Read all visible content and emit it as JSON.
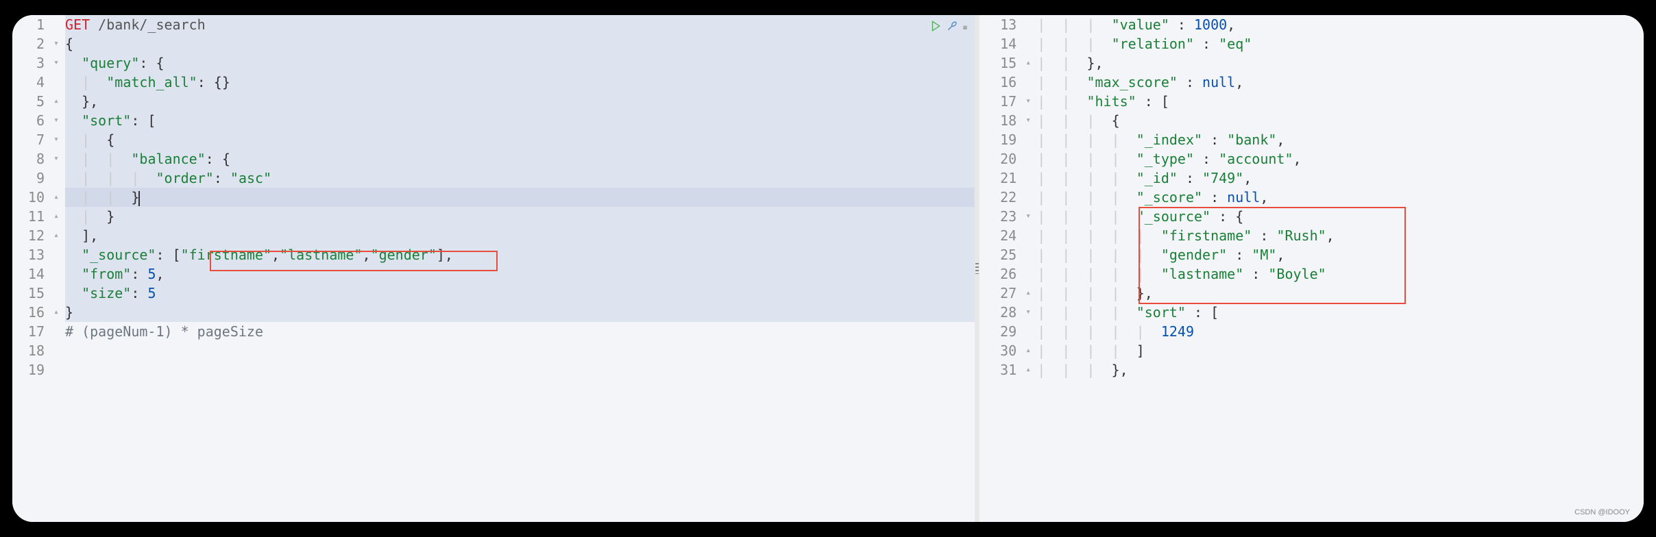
{
  "left_pane": {
    "line_numbers": [
      "1",
      "2",
      "3",
      "4",
      "5",
      "6",
      "7",
      "8",
      "9",
      "10",
      "11",
      "12",
      "13",
      "14",
      "15",
      "16",
      "17",
      "18",
      "19"
    ],
    "fold_markers": [
      "",
      "▾",
      "▾",
      "",
      "▴",
      "▾",
      "▾",
      "▾",
      "",
      "▴",
      "▴",
      "▴",
      "",
      "",
      "",
      "▴",
      "",
      "",
      ""
    ],
    "tokens": {
      "method": "GET",
      "path": " /bank/_search",
      "brace_open": "{",
      "query_key": "\"query\"",
      "match_all_key": "\"match_all\"",
      "empty_obj": "{}",
      "sort_key": "\"sort\"",
      "bracket_open": "[",
      "balance_key": "\"balance\"",
      "order_key": "\"order\"",
      "order_val": "\"asc\"",
      "source_key": "\"_source\"",
      "source_arr_open": "[",
      "source_v1": "\"firstname\"",
      "source_v2": "\"lastname\"",
      "source_v3": "\"gender\"",
      "source_arr_close": "]",
      "from_key": "\"from\"",
      "from_val": "5",
      "size_key": "\"size\"",
      "size_val": "5",
      "bracket_close": "]",
      "brace_close": "}",
      "comment": "# (pageNum-1) * pageSize"
    }
  },
  "right_pane": {
    "line_numbers": [
      "13",
      "14",
      "15",
      "16",
      "17",
      "18",
      "19",
      "20",
      "21",
      "22",
      "23",
      "24",
      "25",
      "26",
      "27",
      "28",
      "29",
      "30",
      "31"
    ],
    "fold_markers": [
      "",
      "",
      "▴",
      "",
      "▾",
      "▾",
      "",
      "",
      "",
      "",
      "▾",
      "",
      "",
      "",
      "▴",
      "▾",
      "",
      "▴",
      "▴"
    ],
    "tokens": {
      "value_key": "\"value\"",
      "value_val": "1000",
      "relation_key": "\"relation\"",
      "relation_val": "\"eq\"",
      "max_score_key": "\"max_score\"",
      "null_val": "null",
      "hits_key": "\"hits\"",
      "index_key": "\"_index\"",
      "index_val": "\"bank\"",
      "type_key": "\"_type\"",
      "type_val": "\"account\"",
      "id_key": "\"_id\"",
      "id_val": "\"749\"",
      "score_key": "\"_score\"",
      "source_key": "\"_source\"",
      "firstname_key": "\"firstname\"",
      "firstname_val": "\"Rush\"",
      "gender_key": "\"gender\"",
      "gender_val": "\"M\"",
      "lastname_key": "\"lastname\"",
      "lastname_val": "\"Boyle\"",
      "sort_key": "\"sort\"",
      "sort_val": "1249"
    }
  },
  "watermark": "CSDN @IDOOY"
}
